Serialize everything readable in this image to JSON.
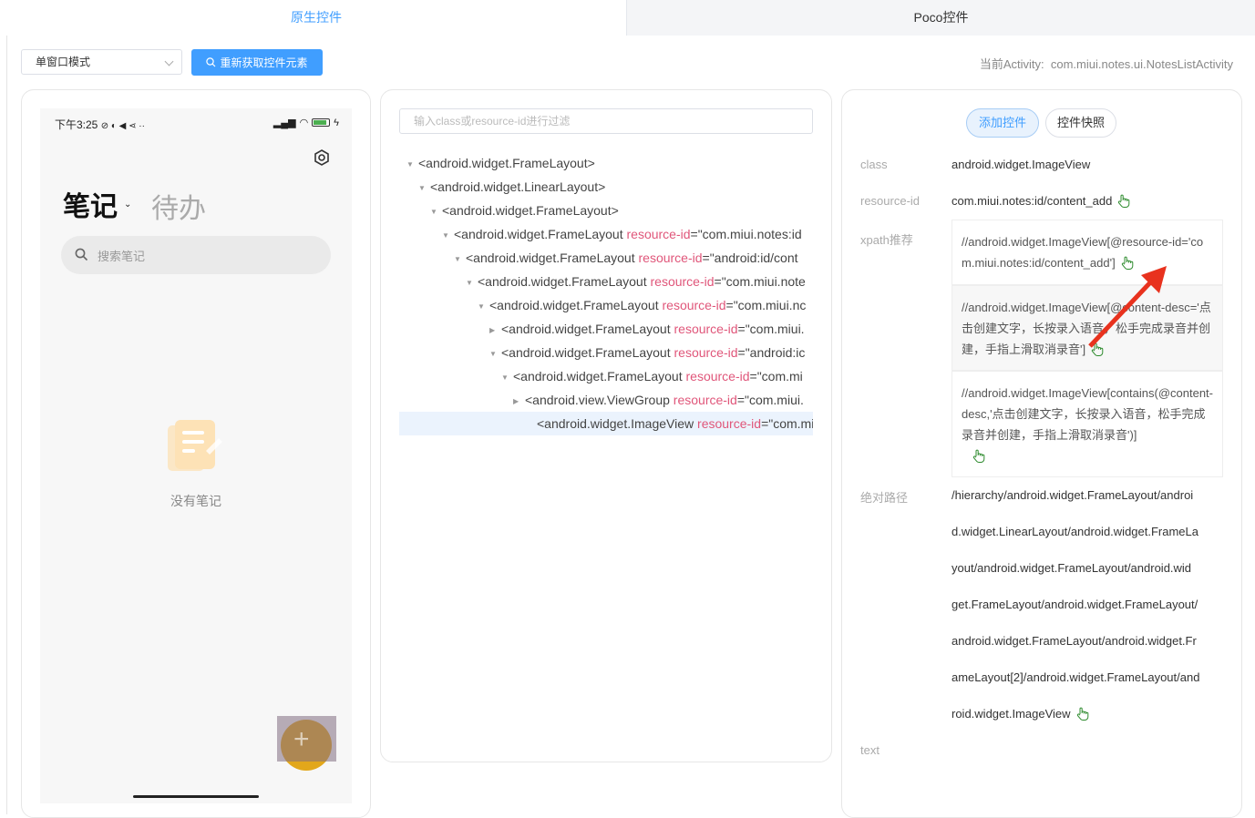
{
  "tabs": {
    "native": "原生控件",
    "poco": "Poco控件"
  },
  "toolbar": {
    "mode_select": "单窗口模式",
    "refresh_button": "重新获取控件元素",
    "activity_label": "当前Activity:",
    "activity_value": "com.miui.notes.ui.NotesListActivity"
  },
  "phone": {
    "status_time": "下午3:25",
    "status_icons": "⊘ ◐ ◀ ⋖ ··",
    "notes_tab": "笔记",
    "todo_tab": "待办",
    "search_placeholder": "搜索笔记",
    "empty_text": "没有笔记"
  },
  "tree": {
    "filter_placeholder": "输入class或resource-id进行过滤",
    "nodes": [
      {
        "tag": "<android.widget.FrameLayout>",
        "attr": "",
        "value": "",
        "expanded": true
      },
      {
        "tag": "<android.widget.LinearLayout>",
        "attr": "",
        "value": "",
        "expanded": true
      },
      {
        "tag": "<android.widget.FrameLayout>",
        "attr": "",
        "value": "",
        "expanded": true
      },
      {
        "tag": "<android.widget.FrameLayout ",
        "attr": "resource-id",
        "value": "=\"com.miui.notes:id",
        "expanded": true
      },
      {
        "tag": "<android.widget.FrameLayout ",
        "attr": "resource-id",
        "value": "=\"android:id/cont",
        "expanded": true
      },
      {
        "tag": "<android.widget.FrameLayout ",
        "attr": "resource-id",
        "value": "=\"com.miui.note",
        "expanded": true
      },
      {
        "tag": "<android.widget.FrameLayout ",
        "attr": "resource-id",
        "value": "=\"com.miui.nc",
        "expanded": true
      },
      {
        "tag": "<android.widget.FrameLayout ",
        "attr": "resource-id",
        "value": "=\"com.miui.",
        "expanded": false
      },
      {
        "tag": "<android.widget.FrameLayout ",
        "attr": "resource-id",
        "value": "=\"android:ic",
        "expanded": true
      },
      {
        "tag": "<android.widget.FrameLayout ",
        "attr": "resource-id",
        "value": "=\"com.mi",
        "expanded": true
      },
      {
        "tag": "<android.view.ViewGroup ",
        "attr": "resource-id",
        "value": "=\"com.miui.",
        "expanded": false
      },
      {
        "tag": "<android.widget.ImageView ",
        "attr": "resource-id",
        "value": "=\"com.mi",
        "expanded": null
      }
    ]
  },
  "details": {
    "add_button": "添加控件",
    "snapshot_button": "控件快照",
    "class_label": "class",
    "class_value": "android.widget.ImageView",
    "resid_label": "resource-id",
    "resid_value": "com.miui.notes:id/content_add",
    "xpath_label": "xpath推荐",
    "xpath_1": "//android.widget.ImageView[@resource-id='com.miui.notes:id/content_add']",
    "xpath_2": "//android.widget.ImageView[@content-desc='点击创建文字，长按录入语音，松手完成录音并创建，手指上滑取消录音']",
    "xpath_3": "//android.widget.ImageView[contains(@content-desc,'点击创建文字，长按录入语音，松手完成录音并创建，手指上滑取消录音')]",
    "abs_label": "绝对路径",
    "abs_lines": [
      "/hierarchy/android.widget.FrameLayout/androi",
      "d.widget.LinearLayout/android.widget.FrameLa",
      "yout/android.widget.FrameLayout/android.wid",
      "get.FrameLayout/android.widget.FrameLayout/",
      "android.widget.FrameLayout/android.widget.Fr",
      "ameLayout[2]/android.widget.FrameLayout/and",
      "roid.widget.ImageView"
    ],
    "text_label": "text"
  },
  "colors": {
    "accent": "#409eff",
    "attr": "#e0567a",
    "hand": "#2e8b2e",
    "arrow": "#e8321e"
  }
}
